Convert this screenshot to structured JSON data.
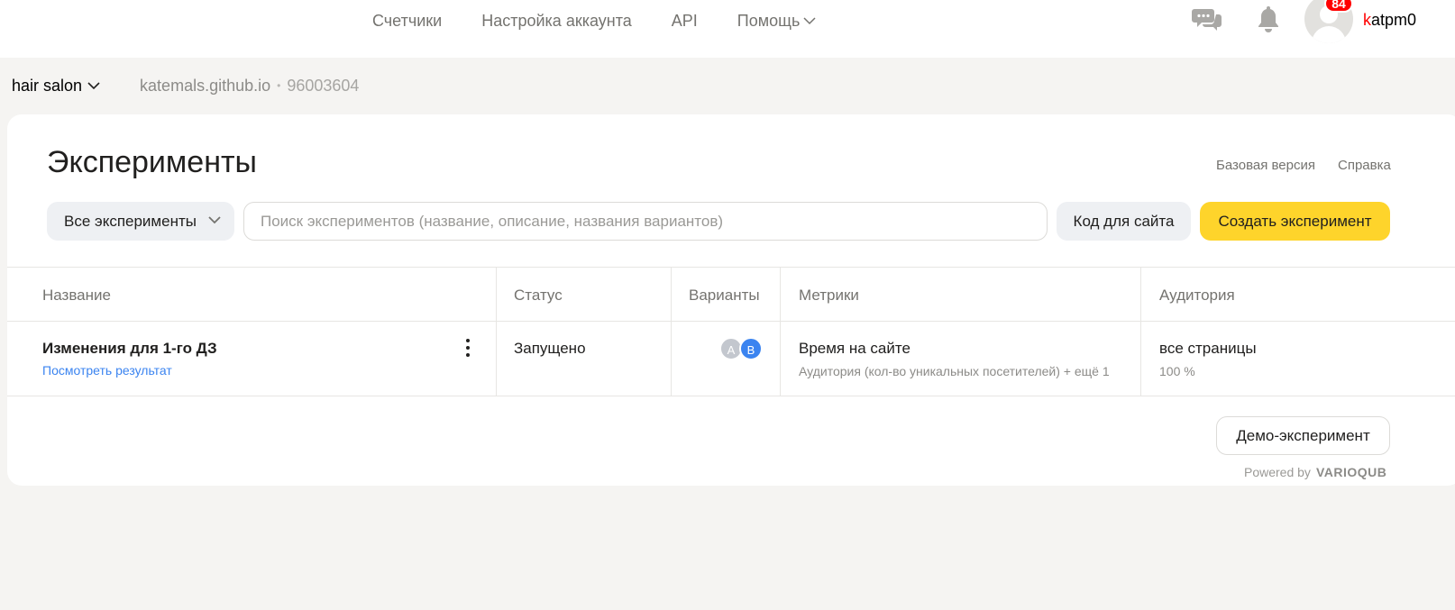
{
  "topbar": {
    "nav": [
      "Счетчики",
      "Настройка аккаунта",
      "API",
      "Помощь"
    ],
    "notifications_count": "84",
    "username_first": "k",
    "username_rest": "atpm0"
  },
  "counter": {
    "name": "hair salon",
    "site": "katemals.github.io",
    "separator": "•",
    "id": "96003604"
  },
  "page": {
    "title": "Эксперименты",
    "links": {
      "basic": "Базовая версия",
      "help": "Справка"
    }
  },
  "toolbar": {
    "filter_value": "Все эксперименты",
    "search_placeholder": "Поиск экспериментов (название, описание, названия вариантов)",
    "code_button": "Код для сайта",
    "create_button": "Создать эксперимент"
  },
  "table": {
    "headers": [
      "Название",
      "Статус",
      "Варианты",
      "Метрики",
      "Аудитория"
    ],
    "rows": [
      {
        "name": "Изменения для 1-го ДЗ",
        "link": "Посмотреть результат",
        "status": "Запущено",
        "variants": [
          "A",
          "B"
        ],
        "metric": "Время на сайте",
        "metric_extra": "Аудитория (кол-во уникальных посетителей) + ещё 1",
        "audience": "все страницы",
        "audience_share": "100 %"
      }
    ]
  },
  "footer": {
    "demo_button": "Демо-эксперимент",
    "powered_by": "Powered by",
    "brand": "VARIOQUB"
  },
  "colors": {
    "accent_yellow": "#fed42b",
    "link_blue": "#3b84f0",
    "badge_red": "#ff0000",
    "page_bg": "#f5f4f2"
  }
}
